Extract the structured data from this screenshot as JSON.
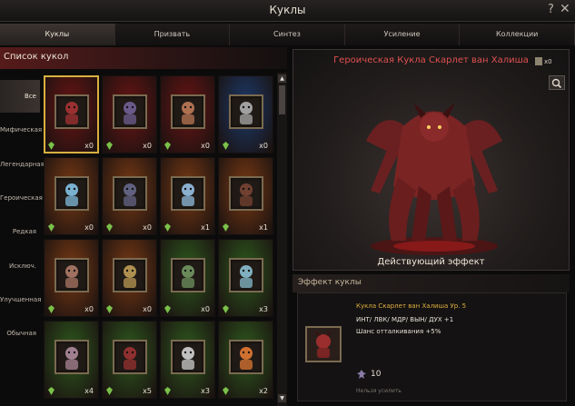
{
  "window": {
    "title": "Куклы",
    "help_glyph": "?",
    "close_glyph": "✕"
  },
  "tabs": [
    {
      "label": "Куклы",
      "active": true
    },
    {
      "label": "Призвать",
      "active": false
    },
    {
      "label": "Синтез",
      "active": false
    },
    {
      "label": "Усиление",
      "active": false
    },
    {
      "label": "Коллекции",
      "active": false
    }
  ],
  "doll_list": {
    "header": "Список кукол",
    "categories": [
      {
        "label": "Все",
        "active": true
      },
      {
        "label": "Мифическая",
        "active": false
      },
      {
        "label": "Легендарная",
        "active": false
      },
      {
        "label": "Героическая",
        "active": false
      },
      {
        "label": "Редкая",
        "active": false
      },
      {
        "label": "Исключ.",
        "active": false
      },
      {
        "label": "Улучшенная",
        "active": false
      },
      {
        "label": "Обычная",
        "active": false
      }
    ],
    "cards": [
      {
        "rarity": "mythic",
        "bg": "#6a1414",
        "count": "x0",
        "selected": true,
        "icon": "imp-doll-icon"
      },
      {
        "rarity": "mythic",
        "bg": "#6a1414",
        "count": "x0",
        "selected": false,
        "icon": "sorceress-doll-icon"
      },
      {
        "rarity": "mythic",
        "bg": "#6a1414",
        "count": "x0",
        "selected": false,
        "icon": "warrior-doll-icon"
      },
      {
        "rarity": "legendary",
        "bg": "#1c3a6c",
        "count": "x0",
        "selected": false,
        "icon": "knight-doll-icon"
      },
      {
        "rarity": "heroic",
        "bg": "#7a3a14",
        "count": "x0",
        "selected": false,
        "icon": "ice-golem-doll-icon"
      },
      {
        "rarity": "heroic",
        "bg": "#7a3a14",
        "count": "x0",
        "selected": false,
        "icon": "dark-knight-doll-icon"
      },
      {
        "rarity": "heroic",
        "bg": "#7a3a14",
        "count": "x1",
        "selected": false,
        "icon": "frost-doll-icon"
      },
      {
        "rarity": "heroic",
        "bg": "#7a3a14",
        "count": "x1",
        "selected": false,
        "icon": "beast-doll-icon"
      },
      {
        "rarity": "heroic",
        "bg": "#7a3a14",
        "count": "x0",
        "selected": false,
        "icon": "dwarf-doll-icon"
      },
      {
        "rarity": "heroic",
        "bg": "#7a3a14",
        "count": "x0",
        "selected": false,
        "icon": "lion-doll-icon"
      },
      {
        "rarity": "rare",
        "bg": "#2e5a1e",
        "count": "x0",
        "selected": false,
        "icon": "toad-doll-icon"
      },
      {
        "rarity": "rare",
        "bg": "#2e5a1e",
        "count": "x3",
        "selected": false,
        "icon": "yeti-doll-icon"
      },
      {
        "rarity": "rare",
        "bg": "#2e5a1e",
        "count": "x4",
        "selected": false,
        "icon": "skeleton-doll-icon"
      },
      {
        "rarity": "rare",
        "bg": "#2e5a1e",
        "count": "x5",
        "selected": false,
        "icon": "goblin-doll-icon"
      },
      {
        "rarity": "rare",
        "bg": "#2e5a1e",
        "count": "x3",
        "selected": false,
        "icon": "ghoul-doll-icon"
      },
      {
        "rarity": "rare",
        "bg": "#2e5a1e",
        "count": "x2",
        "selected": false,
        "icon": "fire-spirit-doll-icon"
      }
    ]
  },
  "preview": {
    "name": "Героическая Кукла Скарлет ван Халиша",
    "owned": "x0",
    "active_effect_label": "Действующий эффект"
  },
  "effect": {
    "header": "Эффект куклы",
    "doll_name": "Кукла Скарлет ван Халиша Ур. 5",
    "stats": "ИНТ/ ЛВК/ МДР/ ВЫН/ ДУХ +1",
    "chance": "Шанс отталкивания +5%",
    "points": "10",
    "note": "Нельзя усилить"
  },
  "colors": {
    "accent_gold": "#e0b040",
    "name_red": "#e05050",
    "gem_green": "#7ac04a"
  }
}
